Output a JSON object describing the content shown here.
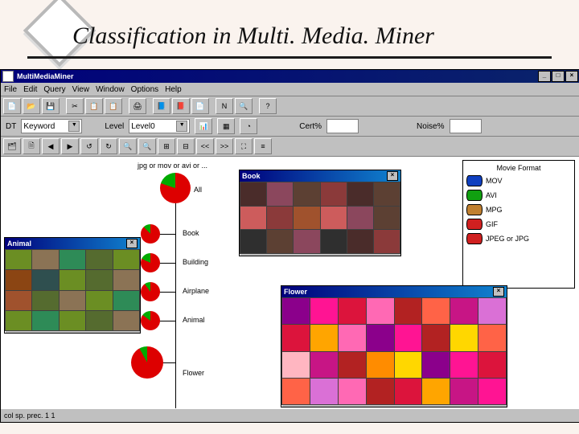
{
  "slide": {
    "title": "Classification in Multi. Media. Miner"
  },
  "app": {
    "title": "MultiMediaMiner",
    "winbtns": {
      "min": "_",
      "max": "□",
      "close": "×"
    },
    "menu": [
      "File",
      "Edit",
      "Query",
      "View",
      "Window",
      "Options",
      "Help"
    ],
    "toolbar1": [
      "📄",
      "📂",
      "💾",
      "|",
      "✂",
      "📋",
      "📋",
      "|",
      "🖨",
      "|",
      "📘",
      "📕",
      "📄",
      "|",
      "N",
      "🔍",
      "|",
      "?"
    ],
    "optbar": {
      "dt_label": "DT",
      "dt_value": "Keyword",
      "level_label": "Level",
      "level_value": "Level0",
      "cert_label": "Cert%",
      "cert_value": "",
      "noise_label": "Noise%",
      "noise_value": ""
    },
    "toolbar2": [
      "🗂",
      "🗎",
      "◀",
      "▶",
      "↺",
      "↻",
      "🔍",
      "🔍",
      "⊞",
      "⊟",
      "<<",
      ">>",
      "⛶",
      "≡"
    ],
    "tree": {
      "root_label": "jpg or mov or avi or ...",
      "nodes": [
        "All",
        "Book",
        "Building",
        "Airplane",
        "Animal",
        "Flower"
      ]
    },
    "legend": {
      "title": "Movie Format",
      "items": [
        {
          "label": "MOV",
          "color": "#1040c0"
        },
        {
          "label": "AVI",
          "color": "#10a010"
        },
        {
          "label": "MPG",
          "color": "#c08030"
        },
        {
          "label": "GIF",
          "color": "#d02020"
        },
        {
          "label": "JPEG or JPG",
          "color": "#d02020"
        }
      ]
    },
    "panels": {
      "animal": "Animal",
      "book": "Book",
      "flower": "Flower"
    },
    "status_left": "col sp. prec. 1 1",
    "status_right": ""
  }
}
